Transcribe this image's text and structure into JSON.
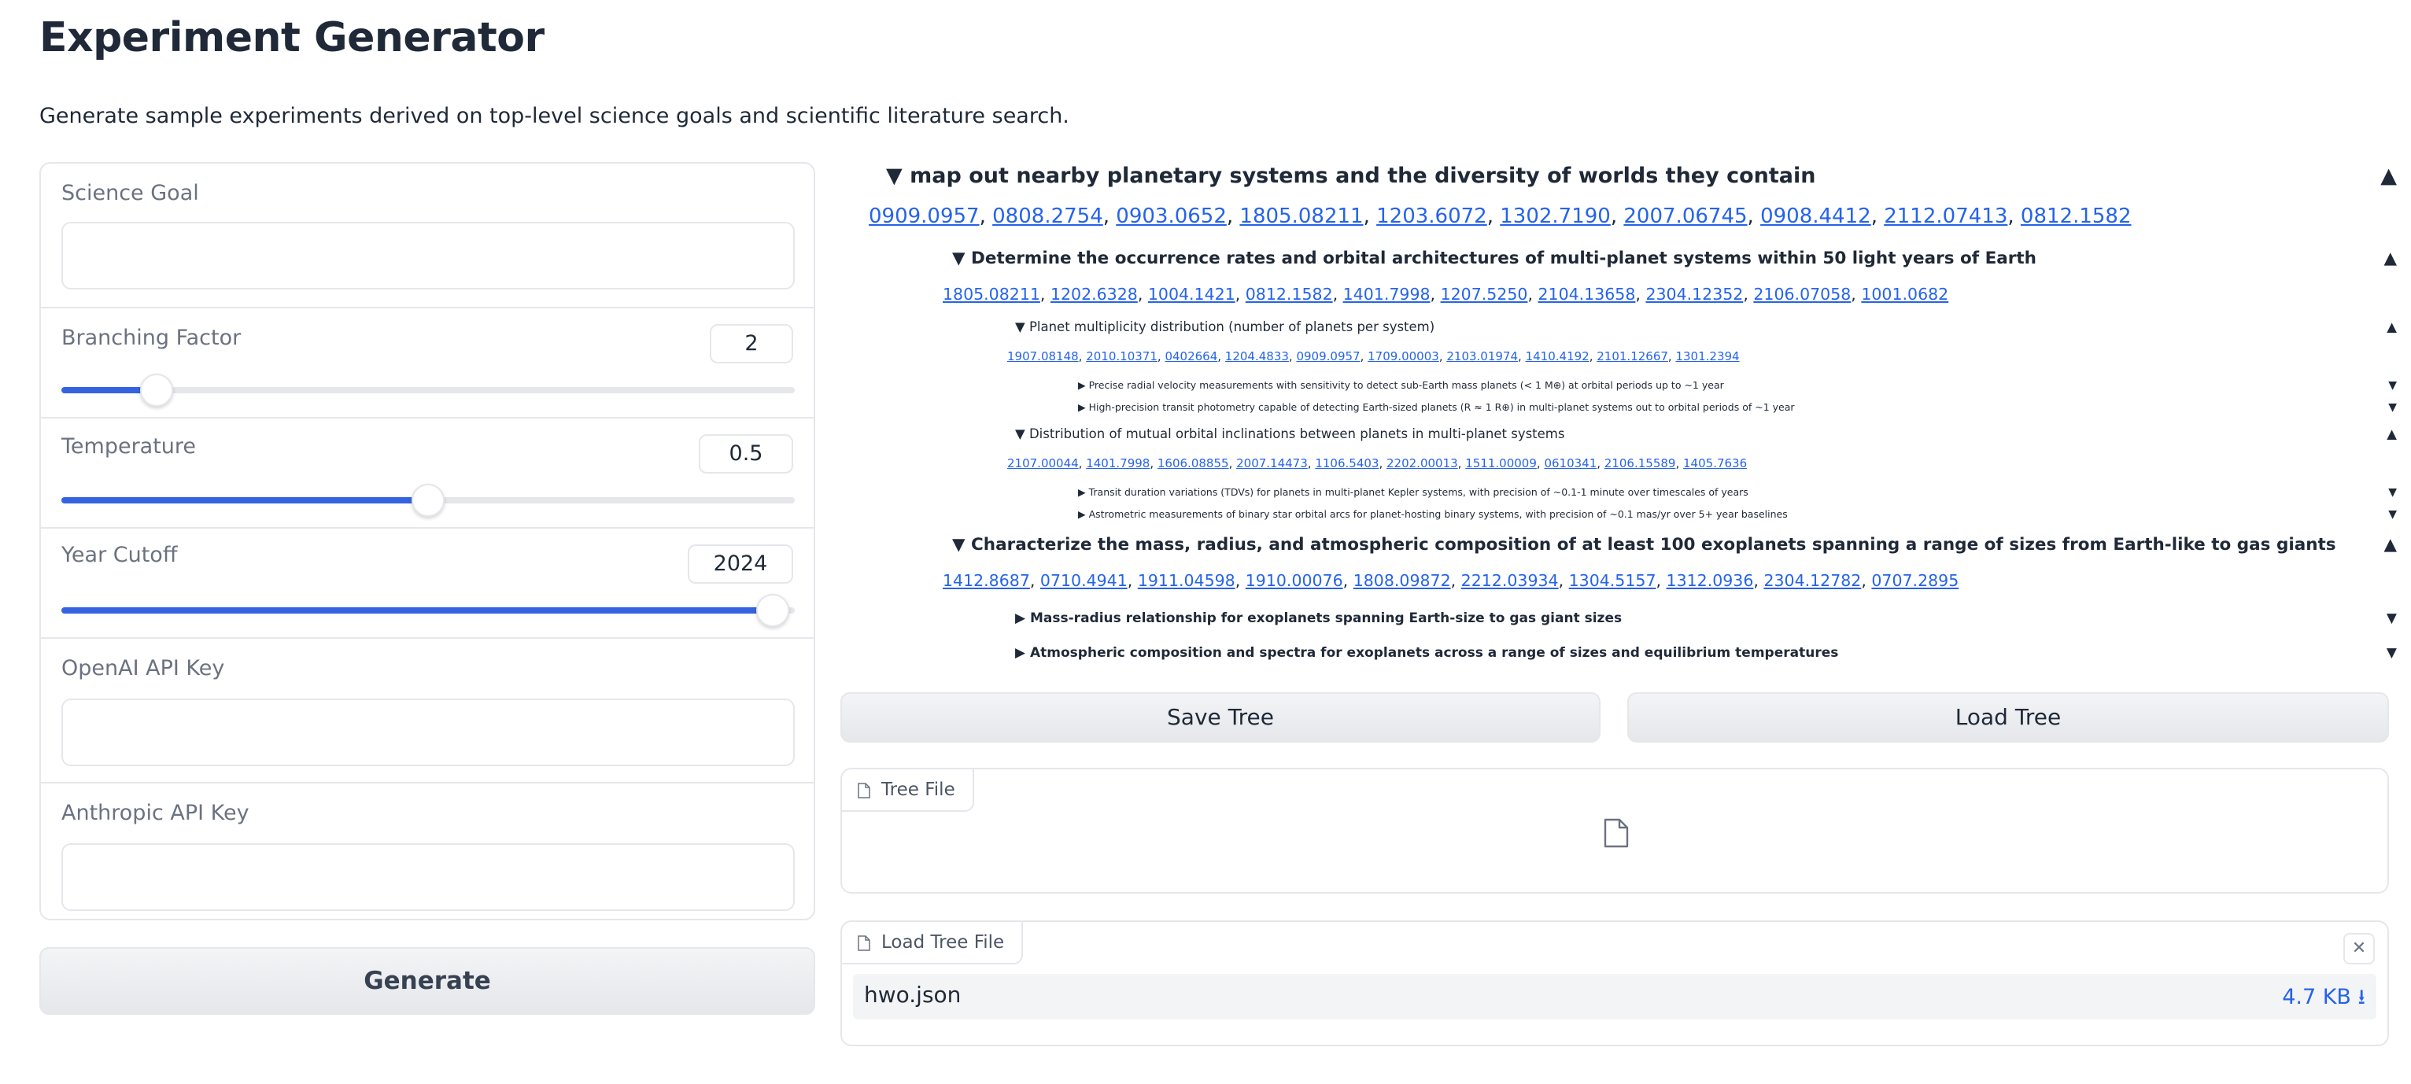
{
  "page": {
    "title": "Experiment Generator",
    "subtitle": "Generate sample experiments derived on top-level science goals and scientific literature search."
  },
  "form": {
    "science_goal": {
      "label": "Science Goal",
      "value": ""
    },
    "branching_factor": {
      "label": "Branching Factor",
      "value": "2",
      "fraction": 0.13
    },
    "temperature": {
      "label": "Temperature",
      "value": "0.5",
      "fraction": 0.5
    },
    "year_cutoff": {
      "label": "Year Cutoff",
      "value": "2024",
      "fraction": 0.97
    },
    "openai_key": {
      "label": "OpenAI API Key",
      "value": ""
    },
    "anthropic_key": {
      "label": "Anthropic API Key",
      "value": ""
    },
    "generate_label": "Generate"
  },
  "tree": {
    "root": {
      "title": "map out nearby planetary systems and the diversity of worlds they contain",
      "papers": [
        "0909.0957",
        "0808.2754",
        "0903.0652",
        "1805.08211",
        "1203.6072",
        "1302.7190",
        "2007.06745",
        "0908.4412",
        "2112.07413",
        "0812.1582"
      ],
      "arrow": "▲"
    },
    "goal1": {
      "title": "Determine the occurrence rates and orbital architectures of multi-planet systems within 50 light years of Earth",
      "papers": [
        "1805.08211",
        "1202.6328",
        "1004.1421",
        "0812.1582",
        "1401.7998",
        "1207.5250",
        "2104.13658",
        "2304.12352",
        "2106.07058",
        "1001.0682"
      ],
      "arrow": "▲"
    },
    "goal1a": {
      "title": "Planet multiplicity distribution (number of planets per system)",
      "papers": [
        "1907.08148",
        "2010.10371",
        "0402664",
        "1204.4833",
        "0909.0957",
        "1709.00003",
        "2103.01974",
        "1410.4192",
        "2101.12667",
        "1301.2394"
      ],
      "arrow": "▲",
      "leaves": [
        {
          "text": "Precise radial velocity measurements with sensitivity to detect sub-Earth mass planets (< 1 M⊕) at orbital periods up to ~1 year",
          "arrow": "▼"
        },
        {
          "text": "High-precision transit photometry capable of detecting Earth-sized planets (R ≈ 1 R⊕) in multi-planet systems out to orbital periods of ~1 year",
          "arrow": "▼"
        }
      ]
    },
    "goal1b": {
      "title": "Distribution of mutual orbital inclinations between planets in multi-planet systems",
      "papers": [
        "2107.00044",
        "1401.7998",
        "1606.08855",
        "2007.14473",
        "1106.5403",
        "2202.00013",
        "1511.00009",
        "0610341",
        "2106.15589",
        "1405.7636"
      ],
      "arrow": "▲",
      "leaves": [
        {
          "text": "Transit duration variations (TDVs) for planets in multi-planet Kepler systems, with precision of ~0.1-1 minute over timescales of years",
          "arrow": "▼"
        },
        {
          "text": "Astrometric measurements of binary star orbital arcs for planet-hosting binary systems, with precision of ~0.1 mas/yr over 5+ year baselines",
          "arrow": "▼"
        }
      ]
    },
    "goal2": {
      "title": "Characterize the mass, radius, and atmospheric composition of at least 100 exoplanets spanning a range of sizes from Earth-like to gas giants",
      "papers": [
        "1412.8687",
        "0710.4941",
        "1911.04598",
        "1910.00076",
        "1808.09872",
        "2212.03934",
        "1304.5157",
        "1312.0936",
        "2304.12782",
        "0707.2895"
      ],
      "arrow": "▲",
      "children": [
        {
          "text": "Mass-radius relationship for exoplanets spanning Earth-size to gas giant sizes",
          "arrow": "▼"
        },
        {
          "text": "Atmospheric composition and spectra for exoplanets across a range of sizes and equilibrium temperatures",
          "arrow": "▼"
        }
      ]
    }
  },
  "buttons": {
    "save_tree": "Save Tree",
    "load_tree": "Load Tree"
  },
  "tree_file": {
    "label": "Tree File"
  },
  "load_tree_file": {
    "label": "Load Tree File",
    "file_name": "hwo.json",
    "file_size": "4.7 KB ⭳",
    "close": "✕"
  },
  "icons": {
    "file": "file-icon",
    "close": "close-icon",
    "download": "download-icon"
  },
  "colors": {
    "accent": "#3563e0",
    "link": "#2563eb"
  }
}
